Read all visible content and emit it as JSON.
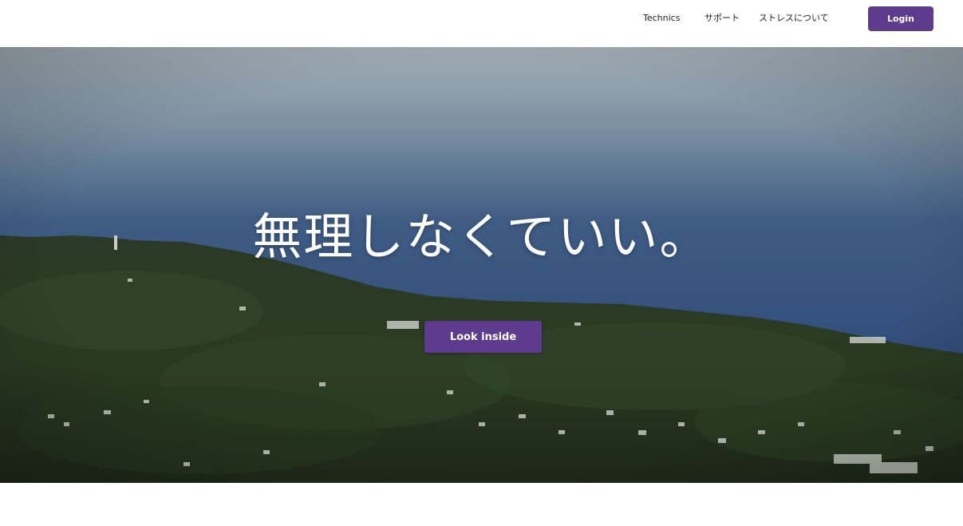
{
  "nav": {
    "links": [
      "Technics",
      "サポート",
      "ストレスについて"
    ],
    "login_label": "Login"
  },
  "hero": {
    "title": "無理しなくていい。",
    "cta_label": "Look inside"
  },
  "colors": {
    "accent": "#5e3b8c",
    "header_bg": "#ffffff",
    "text_dark": "#222222"
  }
}
